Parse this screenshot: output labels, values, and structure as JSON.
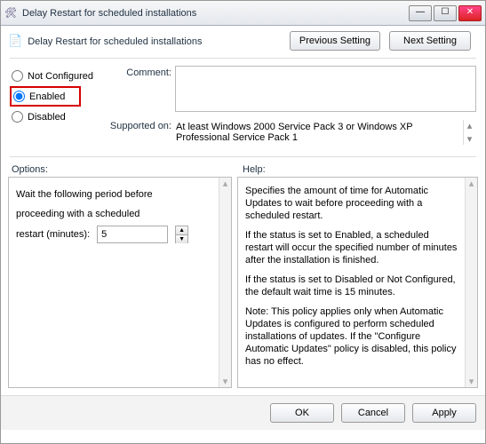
{
  "window": {
    "title": "Delay Restart for scheduled installations",
    "min": "—",
    "max": "☐",
    "close": "✕"
  },
  "header": {
    "title": "Delay Restart for scheduled installations",
    "btn_previous": "Previous Setting",
    "btn_next": "Next Setting"
  },
  "config": {
    "radio_not_configured": "Not Configured",
    "radio_enabled": "Enabled",
    "radio_disabled": "Disabled",
    "selected": "enabled",
    "comment_label": "Comment:",
    "comment_value": "",
    "supported_label": "Supported on:",
    "supported_value": "At least Windows 2000 Service Pack 3 or Windows XP Professional Service Pack 1"
  },
  "mid": {
    "options_label": "Options:",
    "help_label": "Help:"
  },
  "options": {
    "line1": "Wait the following period before",
    "line2": "proceeding with a scheduled",
    "line3_label": "restart (minutes):",
    "value": "5"
  },
  "help": {
    "p1": "Specifies the amount of time for Automatic Updates to wait before proceeding with a scheduled restart.",
    "p2": "If the status is set to Enabled, a scheduled restart will occur the specified number of minutes after the installation is finished.",
    "p3": "If the status is set to Disabled or Not Configured, the default wait time is 15 minutes.",
    "p4": "Note: This policy applies only when Automatic Updates is configured to perform scheduled installations of updates. If the \"Configure Automatic Updates\" policy is disabled, this policy has no effect."
  },
  "footer": {
    "ok": "OK",
    "cancel": "Cancel",
    "apply": "Apply"
  }
}
